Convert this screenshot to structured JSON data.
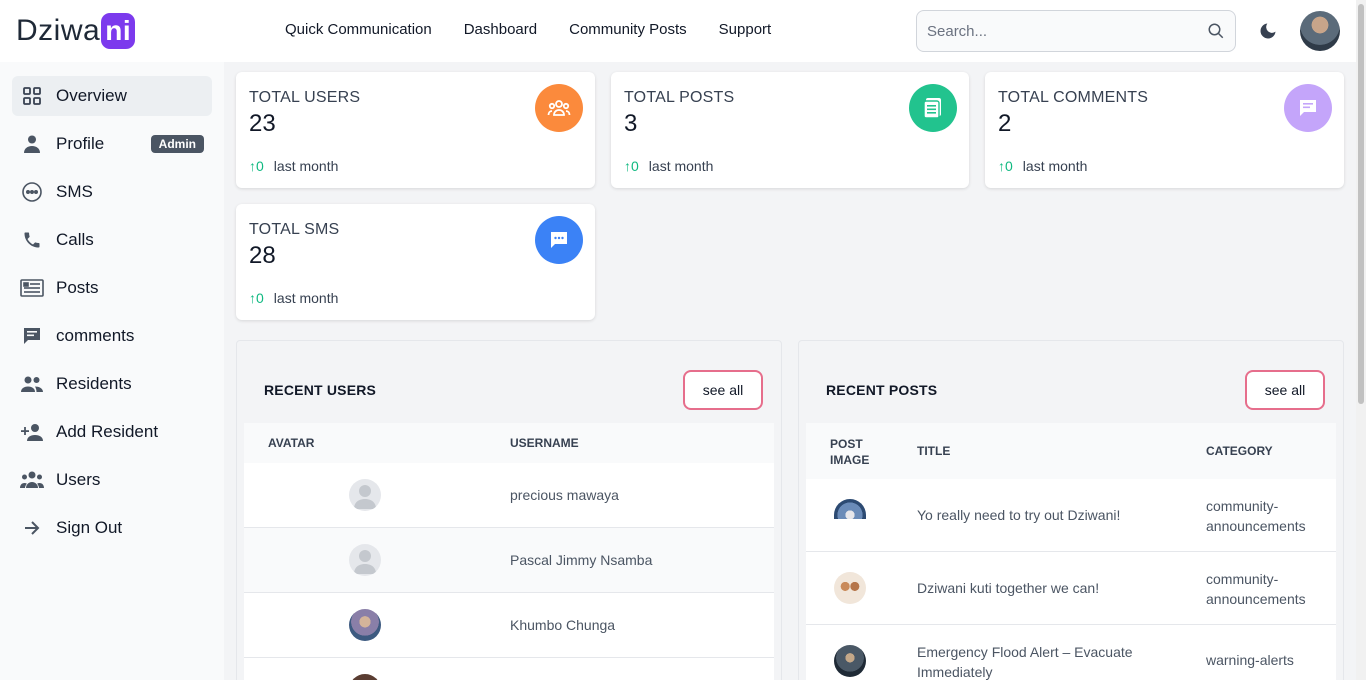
{
  "header": {
    "logo_text": "Dziwa",
    "logo_badge": "ni",
    "nav": [
      "Quick Communication",
      "Dashboard",
      "Community Posts",
      "Support"
    ],
    "search_placeholder": "Search..."
  },
  "sidebar": {
    "items": [
      {
        "label": "Overview",
        "icon": "grid-icon"
      },
      {
        "label": "Profile",
        "icon": "person-icon",
        "badge": "Admin"
      },
      {
        "label": "SMS",
        "icon": "chat-bubble-icon"
      },
      {
        "label": "Calls",
        "icon": "phone-icon"
      },
      {
        "label": "Posts",
        "icon": "newspaper-icon"
      },
      {
        "label": "comments",
        "icon": "comment-icon"
      },
      {
        "label": "Residents",
        "icon": "group-icon"
      },
      {
        "label": "Add Resident",
        "icon": "person-add-icon"
      },
      {
        "label": "Users",
        "icon": "users-icon"
      },
      {
        "label": "Sign Out",
        "icon": "arrow-right-icon"
      }
    ]
  },
  "stats": [
    {
      "label": "TOTAL USERS",
      "value": "23",
      "delta": "0",
      "period": "last month",
      "color": "#fb8a3c"
    },
    {
      "label": "TOTAL POSTS",
      "value": "3",
      "delta": "0",
      "period": "last month",
      "color": "#22c38e"
    },
    {
      "label": "TOTAL COMMENTS",
      "value": "2",
      "delta": "0",
      "period": "last month",
      "color": "#c4a5fa"
    },
    {
      "label": "TOTAL SMS",
      "value": "28",
      "delta": "0",
      "period": "last month",
      "color": "#3b82f6"
    }
  ],
  "recent_users": {
    "title": "RECENT USERS",
    "see_all": "see all",
    "columns": [
      "AVATAR",
      "USERNAME"
    ],
    "rows": [
      {
        "username": "precious mawaya"
      },
      {
        "username": "Pascal Jimmy Nsamba"
      },
      {
        "username": "Khumbo Chunga"
      }
    ]
  },
  "recent_posts": {
    "title": "RECENT POSTS",
    "see_all": "see all",
    "columns": [
      "POST IMAGE",
      "TITLE",
      "CATEGORY"
    ],
    "rows": [
      {
        "title": "Yo really need to try out Dziwani!",
        "category": "community-announcements"
      },
      {
        "title": "Dziwani kuti together we can!",
        "category": "community-announcements"
      },
      {
        "title": "Emergency Flood Alert – Evacuate Immediately",
        "category": "warning-alerts"
      }
    ]
  }
}
